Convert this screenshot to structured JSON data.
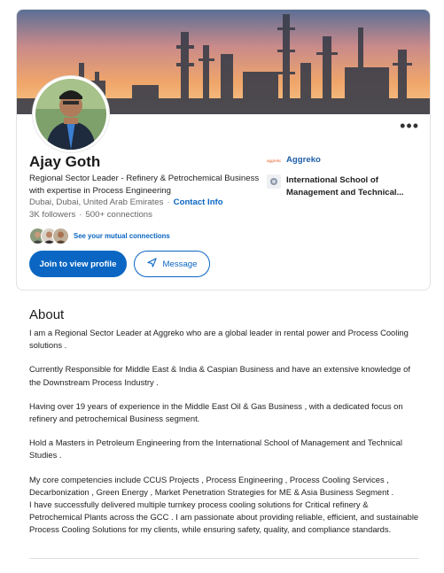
{
  "profile": {
    "name": "Ajay Goth",
    "headline": "Regional Sector Leader - Refinery & Petrochemical Business with expertise in Process Engineering",
    "location": "Dubai, Dubai, United Arab Emirates",
    "location_separator": "·",
    "contact_info_label": "Contact Info",
    "followers": "3K followers",
    "stats_separator": "·",
    "connections": "500+ connections",
    "mutual_label": "See your mutual connections",
    "more_label": "•••"
  },
  "actions": {
    "join_label": "Join to view profile",
    "message_label": "Message"
  },
  "side": {
    "company": "Aggreko",
    "company_logo_text": "aggreko",
    "school": "International School of Management and Technical..."
  },
  "about": {
    "title": "About",
    "paragraphs": [
      "I am a Regional Sector Leader at Aggreko who are a global leader in rental power and Process Cooling solutions .",
      "Currently Responsible for Middle East & India & Caspian Business and have an extensive knowledge of the Downstream Process Industry .",
      "Having over 19 years of experience in the Middle East Oil & Gas Business , with a dedicated focus on refinery and petrochemical Business segment.",
      "Hold a Masters in Petroleum Engineering from the International School of Management and Technical Studies .",
      "My core competencies include CCUS Projects , Process Engineering , Process Cooling Services , Decarbonization , Green Energy , Market Penetration Strategies for ME & Asia Business Segment .",
      "I have successfully delivered multiple turnkey process cooling solutions for Critical refinery & Petrochemical Plants across the GCC . I am passionate about providing reliable, efficient, and sustainable Process Cooling Solutions for my clients, while ensuring safety, quality, and compliance standards."
    ]
  },
  "colors": {
    "accent": "#0a66c2",
    "company_logo": "#e8622a"
  },
  "icons": {
    "message": "paper-plane-icon",
    "more": "more-horizontal-icon"
  }
}
